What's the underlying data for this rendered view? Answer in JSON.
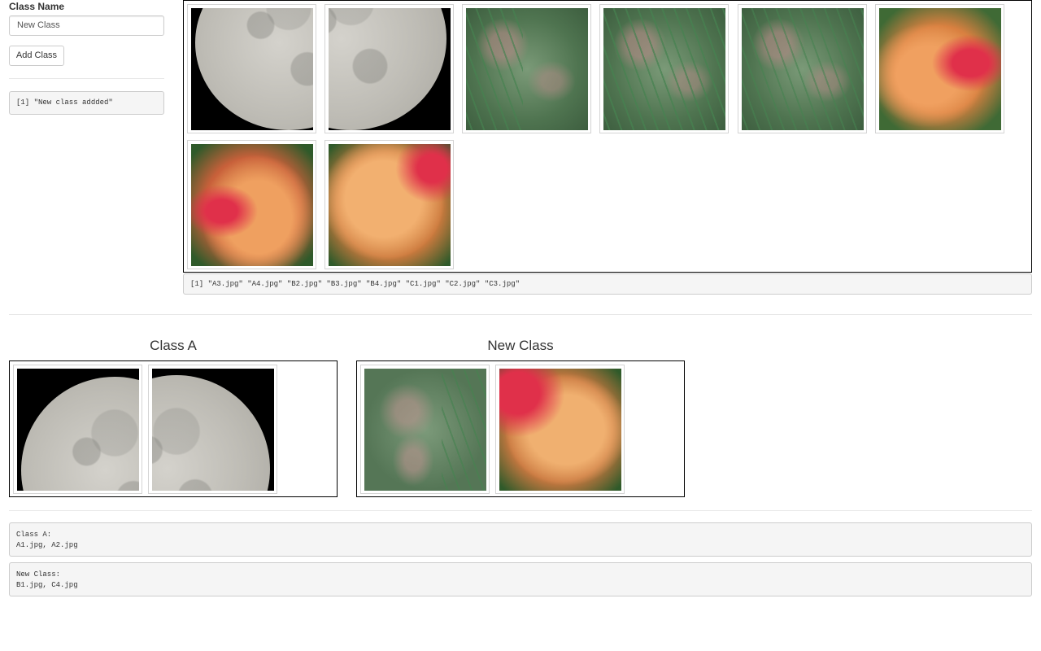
{
  "sidebar": {
    "class_name_label": "Class Name",
    "class_name_value": "New Class",
    "add_button_label": "Add Class",
    "log_output": "[1] \"New class addded\""
  },
  "pool": {
    "images": [
      {
        "name": "A3.jpg",
        "kind": "moon"
      },
      {
        "name": "A4.jpg",
        "kind": "moon"
      },
      {
        "name": "B2.jpg",
        "kind": "pine"
      },
      {
        "name": "B3.jpg",
        "kind": "pine"
      },
      {
        "name": "B4.jpg",
        "kind": "pine"
      },
      {
        "name": "C1.jpg",
        "kind": "flower"
      },
      {
        "name": "C2.jpg",
        "kind": "flower"
      },
      {
        "name": "C3.jpg",
        "kind": "flower"
      }
    ],
    "output": "[1] \"A3.jpg\" \"A4.jpg\" \"B2.jpg\" \"B3.jpg\" \"B4.jpg\" \"C1.jpg\" \"C2.jpg\" \"C3.jpg\""
  },
  "classes": [
    {
      "title": "Class A",
      "images": [
        "A1.jpg",
        "A2.jpg"
      ]
    },
    {
      "title": "New Class",
      "images": [
        "B1.jpg",
        "C4.jpg"
      ]
    }
  ],
  "summaries": [
    {
      "text": "Class A:\nA1.jpg, A2.jpg"
    },
    {
      "text": "New Class:\nB1.jpg, C4.jpg"
    }
  ]
}
